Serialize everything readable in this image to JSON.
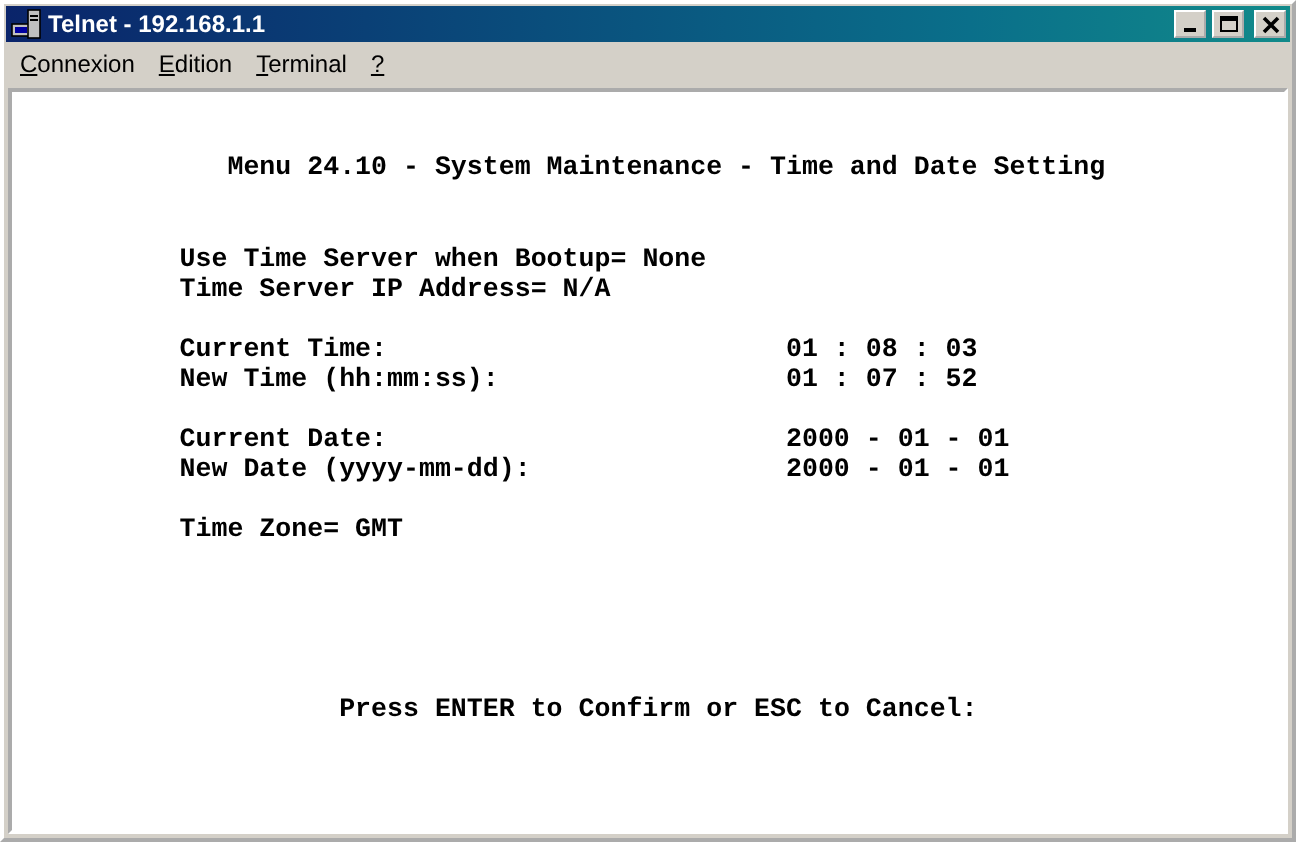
{
  "window": {
    "title": "Telnet - 192.168.1.1"
  },
  "menu": [
    {
      "label": "Connexion"
    },
    {
      "label": "Edition"
    },
    {
      "label": "Terminal"
    },
    {
      "label": "?"
    }
  ],
  "terminal": {
    "heading": "Menu 24.10 - System Maintenance - Time and Date Setting",
    "groups": [
      [
        {
          "kind": "inline",
          "label": "Use Time Server when Bootup=",
          "value": "None"
        },
        {
          "kind": "inline",
          "label": "Time Server IP Address=",
          "value": "N/A"
        }
      ],
      [
        {
          "kind": "column",
          "label": "Current Time:",
          "value": "01 : 08 : 03"
        },
        {
          "kind": "column",
          "label": "New Time (hh:mm:ss):",
          "value": "01 : 07 : 52"
        }
      ],
      [
        {
          "kind": "column",
          "label": "Current Date:",
          "value": "2000 - 01 - 01"
        },
        {
          "kind": "column",
          "label": "New Date (yyyy-mm-dd):",
          "value": "2000 - 01 - 01"
        }
      ],
      [
        {
          "kind": "inline",
          "label": "Time Zone=",
          "value": "GMT"
        }
      ]
    ],
    "prompt": "Press ENTER to Confirm or ESC to Cancel:"
  }
}
